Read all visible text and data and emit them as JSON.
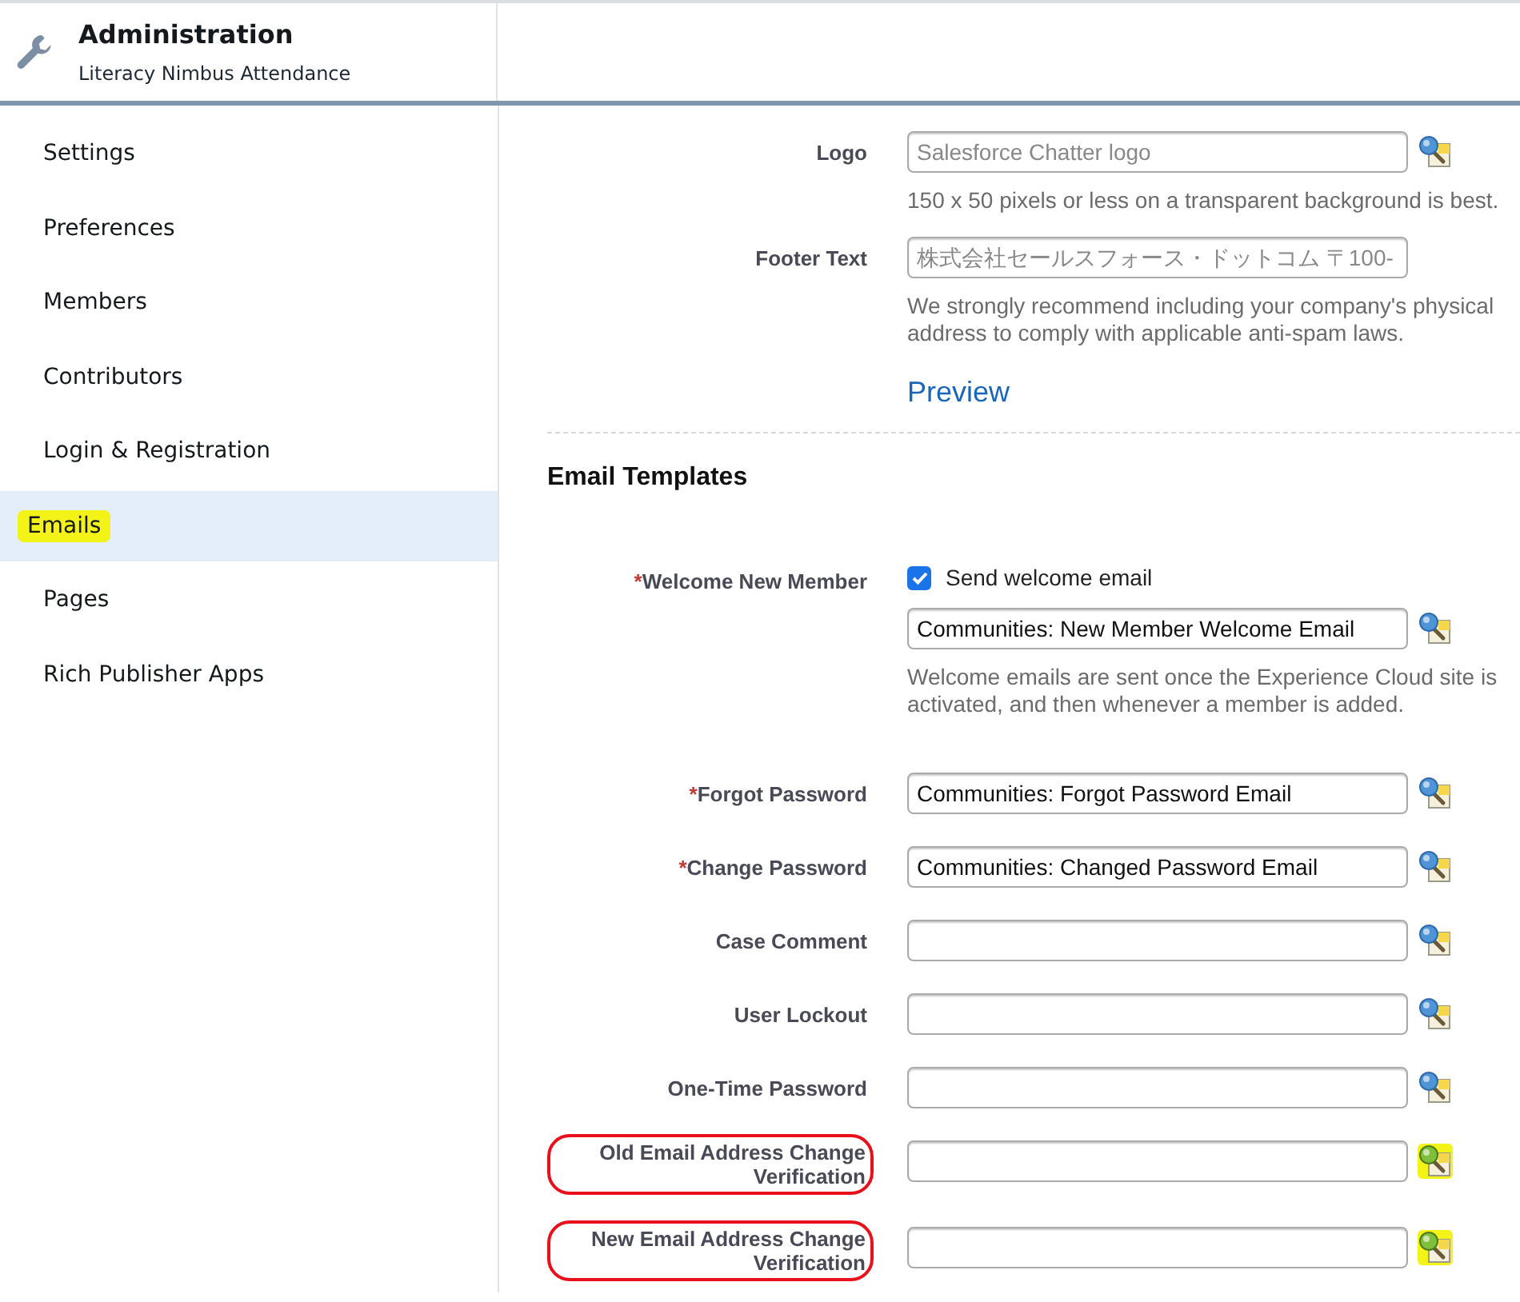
{
  "header": {
    "title": "Administration",
    "subtitle": "Literacy Nimbus Attendance"
  },
  "sidebar": {
    "items": [
      {
        "label": "Settings",
        "selected": false,
        "highlighted": false
      },
      {
        "label": "Preferences",
        "selected": false,
        "highlighted": false
      },
      {
        "label": "Members",
        "selected": false,
        "highlighted": false
      },
      {
        "label": "Contributors",
        "selected": false,
        "highlighted": false
      },
      {
        "label": "Login & Registration",
        "selected": false,
        "highlighted": false
      },
      {
        "label": "Emails",
        "selected": true,
        "highlighted": true
      },
      {
        "label": "Pages",
        "selected": false,
        "highlighted": false
      },
      {
        "label": "Rich Publisher Apps",
        "selected": false,
        "highlighted": false
      }
    ]
  },
  "branding": [
    {
      "label": "Logo",
      "placeholder": "Salesforce Chatter logo",
      "lookup": true,
      "hint": "150 x 50 pixels or less on a transparent background is best."
    },
    {
      "label": "Footer Text",
      "placeholder": "株式会社セールスフォース・ドットコム 〒100-",
      "lookup": false,
      "hint": "We strongly recommend including your company's physical address to comply with applicable anti-spam laws."
    }
  ],
  "preview_link": "Preview",
  "email_templates": {
    "title": "Email Templates",
    "rows": [
      {
        "label": "Welcome New Member",
        "required_mark": "*",
        "circled": false,
        "checkbox": {
          "label": "Send welcome email",
          "checked": true
        },
        "value": "Communities: New Member Welcome Email",
        "lookup_highlighted": false,
        "hint": "Welcome emails are sent once the Experience Cloud site is activated, and then whenever a member is added."
      },
      {
        "label": "Forgot Password",
        "required_mark": "*",
        "circled": false,
        "value": "Communities: Forgot Password Email",
        "lookup_highlighted": false
      },
      {
        "label": "Change Password",
        "required_mark": "*",
        "circled": false,
        "value": "Communities: Changed Password Email",
        "lookup_highlighted": false
      },
      {
        "label": "Case Comment",
        "circled": false,
        "lookup_highlighted": false
      },
      {
        "label": "User Lockout",
        "circled": false,
        "lookup_highlighted": false
      },
      {
        "label": "One-Time Password",
        "circled": false,
        "lookup_highlighted": false
      },
      {
        "label": "Old Email Address Change Verification",
        "circled": true,
        "lookup_highlighted": true
      },
      {
        "label": "New Email Address Change Verification",
        "circled": true,
        "lookup_highlighted": true
      }
    ]
  }
}
